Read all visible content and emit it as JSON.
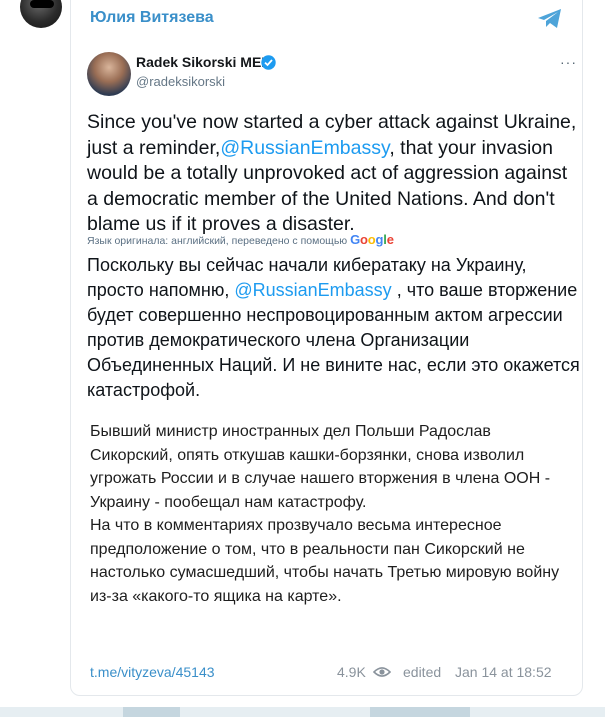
{
  "channel": {
    "author": "Юлия Витязева",
    "share_icon": "telegram-share-icon"
  },
  "tweet": {
    "name": "Radek Sikorski MEP",
    "handle": "@radeksikorski",
    "more": "···",
    "text_part1": "Since you've now started a cyber attack against Ukraine, just a reminder,",
    "mention": "@RussianEmbassy",
    "text_part2": ", that your invasion would be a totally unprovoked act of aggression against a democratic member of the United Nations. And don't blame us if it proves a disaster.",
    "translated_note": "Язык оригинала: английский, переведено с помощью",
    "google_letters": [
      "G",
      "o",
      "o",
      "g",
      "l",
      "e"
    ],
    "translation_part1": "Поскольку вы сейчас начали кибератаку на Украину, просто напомню, ",
    "translation_mention": "@RussianEmbassy",
    "translation_part2": " , что ваше вторжение будет совершенно неспровоцированным актом агрессии против демократического члена Организации Объединенных Наций. И не вините нас, если это окажется катастрофой."
  },
  "post": {
    "paragraph1": "Бывший министр иностранных дел Польши Радослав Сикорский, опять откушав кашки-борзянки, снова изволил угрожать России и в случае нашего вторжения в члена ООН - Украину - пообещал нам катастрофу.",
    "paragraph2": "На что в комментариях прозвучало весьма интересное предположение о том, что в реальности пан Сикорский не настолько сумасшедший, чтобы начать Третью мировую войну из-за «какого-то ящика на карте»."
  },
  "footer": {
    "link": "t.me/vityzeva/45143",
    "views": "4.9K",
    "edited": "edited",
    "date": "Jan 14 at 18:52"
  },
  "colors": {
    "accent": "#3a8fc9",
    "mention": "#1d9bf0",
    "verified": "#1d9bf0"
  }
}
